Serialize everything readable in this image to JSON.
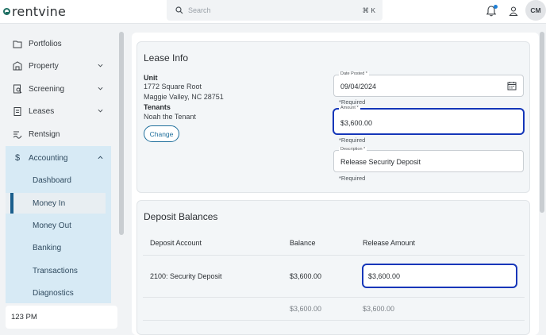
{
  "brand": {
    "name": "rentvine"
  },
  "search": {
    "placeholder": "Search",
    "shortcut": "⌘ K"
  },
  "user": {
    "initials": "CM"
  },
  "sidebar": {
    "items": [
      {
        "label": "Portfolios",
        "icon": "folder-icon"
      },
      {
        "label": "Property",
        "icon": "building-icon"
      },
      {
        "label": "Screening",
        "icon": "screening-icon"
      },
      {
        "label": "Leases",
        "icon": "clipboard-icon"
      },
      {
        "label": "Rentsign",
        "icon": "signature-icon"
      },
      {
        "label": "Accounting",
        "icon": "dollar-icon"
      }
    ],
    "accounting_sub": [
      "Dashboard",
      "Money In",
      "Money Out",
      "Banking",
      "Transactions",
      "Diagnostics"
    ],
    "active_sub": "Money In",
    "bottom_label": "123 PM"
  },
  "lease_info": {
    "title": "Lease Info",
    "unit_label": "Unit",
    "unit_line1": "1772 Square Root",
    "unit_line2": "Maggie Valley, NC 28751",
    "tenants_label": "Tenants",
    "tenant_name": "Noah the Tenant",
    "change_label": "Change",
    "date_posted": {
      "label": "Date Posted *",
      "value": "09/04/2024",
      "hint": "*Required"
    },
    "amount": {
      "label": "Amount *",
      "value": "$3,600.00",
      "hint": "*Required"
    },
    "description": {
      "label": "Description *",
      "value": "Release Security Deposit",
      "hint": "*Required"
    }
  },
  "deposit_balances": {
    "title": "Deposit Balances",
    "columns": [
      "Deposit Account",
      "Balance",
      "Release Amount"
    ],
    "row": {
      "account": "2100: Security Deposit",
      "balance": "$3,600.00",
      "release": "$3,600.00"
    },
    "totals": {
      "balance": "$3,600.00",
      "release": "$3,600.00"
    }
  },
  "colors": {
    "accent": "#1436b9",
    "sidebar_group": "#d7eaf5",
    "active_bar": "#1b5e8c"
  }
}
